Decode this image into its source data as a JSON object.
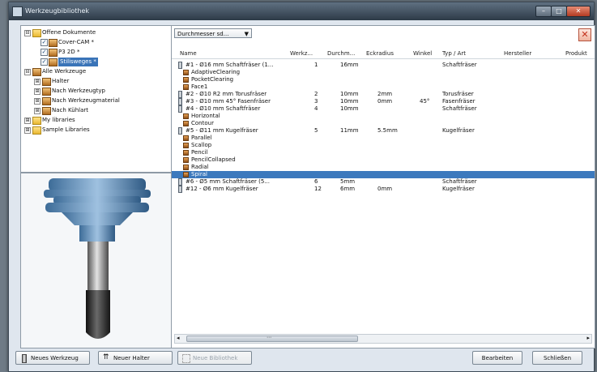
{
  "window": {
    "title": "Werkzeugbibliothek"
  },
  "tree": [
    {
      "label": "Offene Dokumente",
      "expander": "⊟",
      "icon": "folder"
    },
    {
      "label": "Cover-CAM *",
      "check": "✓",
      "icon": "tool"
    },
    {
      "label": "P3 2D *",
      "check": "✓",
      "icon": "tool"
    },
    {
      "label": "Stilisweges *",
      "check": "✓",
      "icon": "tool"
    },
    {
      "label": "Alle Werkzeuge",
      "expander": "⊟",
      "icon": "folder"
    },
    {
      "label": "Halter",
      "expander": "⊞",
      "icon": "tool"
    },
    {
      "label": "Nach Werkzeugtyp",
      "expander": "⊞",
      "icon": "tool"
    },
    {
      "label": "Nach Werkzeugmaterial",
      "expander": "⊞",
      "icon": "tool"
    },
    {
      "label": "Nach Kühlart",
      "expander": "⊞",
      "icon": "tool"
    },
    {
      "label": "My libraries",
      "expander": "⊞",
      "icon": "folder"
    },
    {
      "label": "Sample Libraries",
      "expander": "⊞",
      "icon": "folder"
    }
  ],
  "toolbar": {
    "filter": "Durchmesser sd...",
    "filter_arrow": "▼",
    "close": "✕"
  },
  "columns": [
    "Name",
    "Werkz...",
    "Durchm...",
    "Eckradius",
    "Winkel",
    "Typ / Art",
    "Hersteller",
    "Produkt"
  ],
  "rows": [
    {
      "type": "tool",
      "name": "#1 - Ø16 mm Schaftfräser (1...",
      "nr": "1",
      "diam": "16mm",
      "radius": "",
      "angle": "",
      "type_label": "Schaftfräser"
    },
    {
      "type": "op",
      "name": "AdaptiveClearing"
    },
    {
      "type": "op",
      "name": "PocketClearing"
    },
    {
      "type": "op",
      "name": "Face1"
    },
    {
      "type": "tool",
      "name": "#2 - Ø10 R2 mm Torusfräser",
      "nr": "2",
      "diam": "10mm",
      "radius": "2mm",
      "angle": "",
      "type_label": "Torusfräser"
    },
    {
      "type": "tool",
      "name": "#3 - Ø10 mm 45° Fasenfräser",
      "nr": "3",
      "diam": "10mm",
      "radius": "0mm",
      "angle": "45°",
      "type_label": "Fasenfräser"
    },
    {
      "type": "tool",
      "name": "#4 - Ø10 mm Schaftfräser",
      "nr": "4",
      "diam": "10mm",
      "radius": "",
      "angle": "",
      "type_label": "Schaftfräser"
    },
    {
      "type": "op",
      "name": "Horizontal"
    },
    {
      "type": "op",
      "name": "Contour"
    },
    {
      "type": "tool",
      "name": "#5 - Ø11 mm Kugelfräser",
      "nr": "5",
      "diam": "11mm",
      "radius": "5.5mm",
      "angle": "",
      "type_label": "Kugelfräser"
    },
    {
      "type": "op",
      "name": "Parallel"
    },
    {
      "type": "op",
      "name": "Scallop"
    },
    {
      "type": "op",
      "name": "Pencil"
    },
    {
      "type": "op",
      "name": "PencilCollapsed"
    },
    {
      "type": "op",
      "name": "Radial"
    },
    {
      "type": "op",
      "name": "Spiral",
      "selected": true
    },
    {
      "type": "tool",
      "name": "#6 - Ø5 mm Schaftfräser (5...",
      "nr": "6",
      "diam": "5mm",
      "radius": "",
      "angle": "",
      "type_label": "Schaftfräser"
    },
    {
      "type": "tool",
      "name": "#12 - Ø6 mm Kugelfräser",
      "nr": "12",
      "diam": "6mm",
      "radius": "0mm",
      "angle": "",
      "type_label": "Kugelfräser"
    }
  ],
  "buttons": {
    "new_tool": "Neues Werkzeug",
    "new_holder": "Neuer Halter",
    "new_library": "Neue Bibliothek",
    "edit": "Bearbeiten",
    "close": "Schließen"
  },
  "scroll": {
    "left": "◂",
    "right": "▸",
    "grip": "⋯"
  }
}
